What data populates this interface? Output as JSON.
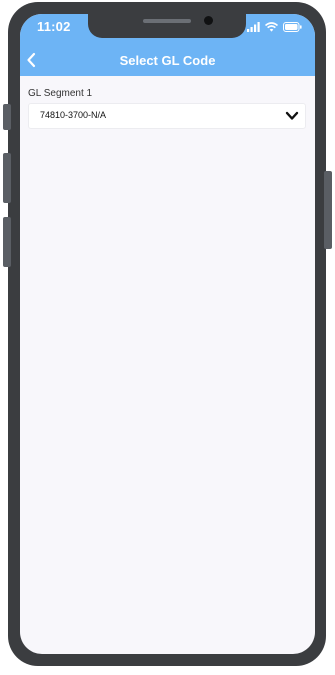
{
  "status_bar": {
    "time": "11:02",
    "icons": [
      "signal-icon",
      "wifi-icon",
      "battery-icon"
    ]
  },
  "header": {
    "title": "Select GL Code",
    "back_icon": "chevron-left-icon",
    "background_color": "#6db4f5"
  },
  "form": {
    "gl_segment_1": {
      "label": "GL Segment 1",
      "value": "74810-3700-N/A",
      "dropdown_icon": "chevron-down-icon"
    }
  },
  "colors": {
    "accent": "#6db4f5",
    "screen_background": "#f8f7fb",
    "frame": "#3b3d40"
  }
}
